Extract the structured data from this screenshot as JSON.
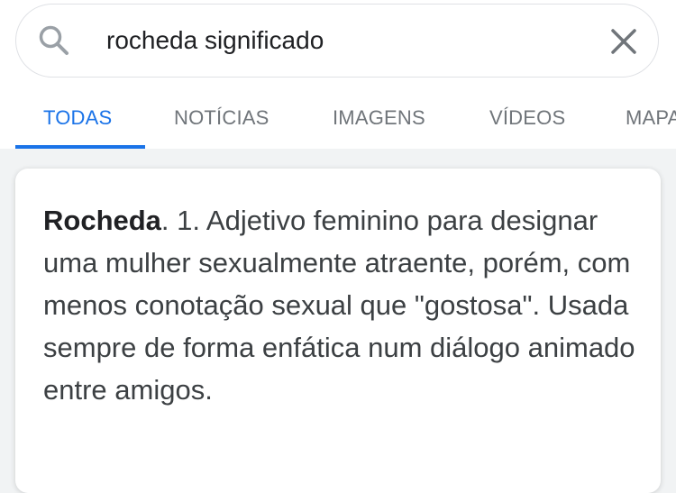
{
  "search": {
    "query": "rocheda significado"
  },
  "tabs": [
    {
      "label": "TODAS",
      "active": true
    },
    {
      "label": "NOTÍCIAS",
      "active": false
    },
    {
      "label": "IMAGENS",
      "active": false
    },
    {
      "label": "VÍDEOS",
      "active": false
    },
    {
      "label": "MAPAS",
      "active": false
    }
  ],
  "definition": {
    "term": "Rocheda",
    "text": ". 1. Adjetivo feminino para designar uma mulher sexualmente atraente, porém, com menos conotação sexual que \"gostosa\". Usada sempre de forma enfática num diálogo animado entre amigos."
  },
  "colors": {
    "accent": "#1a73e8",
    "tab_inactive": "#70757a",
    "page_background": "#f1f3f4"
  },
  "icons": {
    "search": "search-icon",
    "clear": "close-icon"
  }
}
